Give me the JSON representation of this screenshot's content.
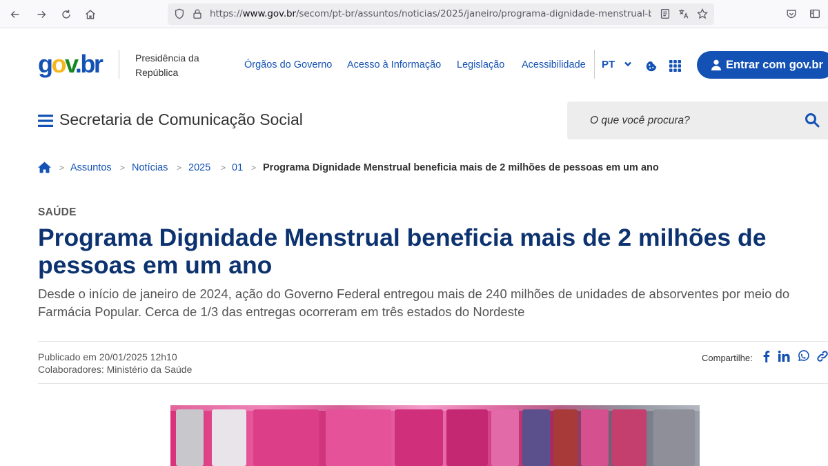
{
  "browser": {
    "url_prefix": "https://",
    "url_domain": "www.gov.br",
    "url_path": "/secom/pt-br/assuntos/noticias/2025/janeiro/programa-dignidade-menstrual-benefici"
  },
  "header": {
    "org_line1": "Presidência da",
    "org_line2": "República",
    "nav": [
      "Órgãos do Governo",
      "Acesso à Informação",
      "Legislação",
      "Acessibilidade"
    ],
    "language": "PT",
    "login_label": "Entrar com gov.br"
  },
  "site": {
    "title": "Secretaria de Comunicação Social",
    "search_placeholder": "O que você procura?"
  },
  "breadcrumb": {
    "items": [
      "Assuntos",
      "Notícias",
      "2025",
      "01"
    ],
    "current": "Programa Dignidade Menstrual beneficia mais de 2 milhões de pessoas em um ano"
  },
  "article": {
    "category": "SAÚDE",
    "headline": "Programa Dignidade Menstrual beneficia mais de 2 milhões de pessoas em um ano",
    "subtitle": "Desde o início de janeiro de 2024, ação do Governo Federal entregou mais de 240 milhões de unidades de absorventes por meio do Farmácia Popular. Cerca de 1/3 das entregas ocorreram em três estados do Nordeste",
    "published": "Publicado em 20/01/2025 12h10",
    "contributors": "Colaboradores: Ministério da Saúde",
    "share_label": "Compartilhe:"
  },
  "colors": {
    "primary": "#1351b4",
    "headline": "#0c326f"
  }
}
